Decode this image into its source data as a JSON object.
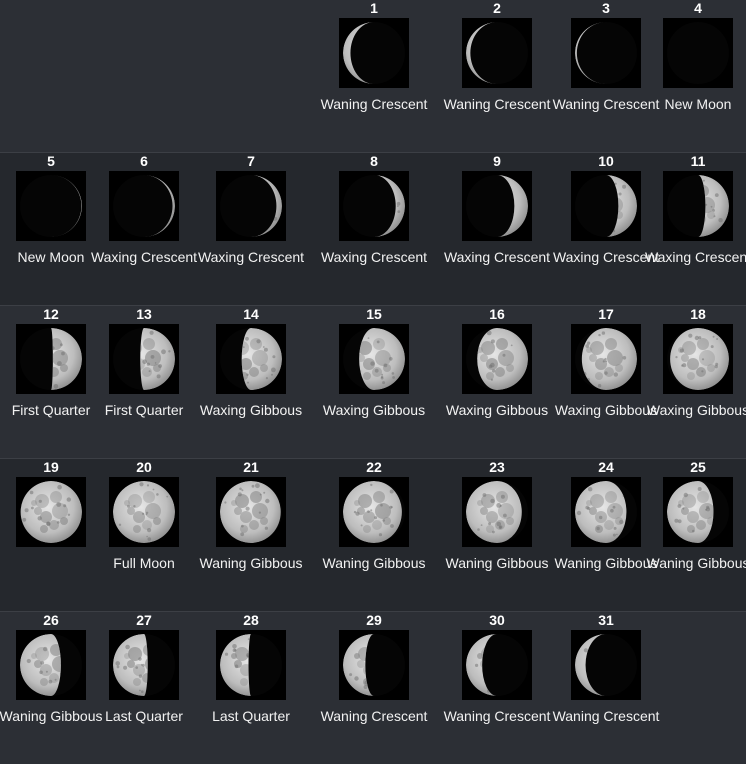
{
  "calendar": {
    "weeks": [
      {
        "days": [
          {
            "day": "1",
            "phase": "Waning Crescent",
            "illumination": 0.12,
            "waxing": false
          },
          {
            "day": "2",
            "phase": "Waning Crescent",
            "illumination": 0.07,
            "waxing": false
          },
          {
            "day": "3",
            "phase": "Waning Crescent",
            "illumination": 0.03,
            "waxing": false
          },
          {
            "day": "4",
            "phase": "New Moon",
            "illumination": 0.0,
            "waxing": false
          }
        ]
      },
      {
        "days": [
          {
            "day": "5",
            "phase": "New Moon",
            "illumination": 0.01,
            "waxing": true
          },
          {
            "day": "6",
            "phase": "Waxing Crescent",
            "illumination": 0.04,
            "waxing": true
          },
          {
            "day": "7",
            "phase": "Waxing Crescent",
            "illumination": 0.09,
            "waxing": true
          },
          {
            "day": "8",
            "phase": "Waxing Crescent",
            "illumination": 0.15,
            "waxing": true
          },
          {
            "day": "9",
            "phase": "Waxing Crescent",
            "illumination": 0.22,
            "waxing": true
          },
          {
            "day": "10",
            "phase": "Waxing Crescent",
            "illumination": 0.3,
            "waxing": true
          },
          {
            "day": "11",
            "phase": "Waxing Crescent",
            "illumination": 0.38,
            "waxing": true
          }
        ]
      },
      {
        "days": [
          {
            "day": "12",
            "phase": "First Quarter",
            "illumination": 0.47,
            "waxing": true
          },
          {
            "day": "13",
            "phase": "First Quarter",
            "illumination": 0.56,
            "waxing": true
          },
          {
            "day": "14",
            "phase": "Waxing Gibbous",
            "illumination": 0.65,
            "waxing": true
          },
          {
            "day": "15",
            "phase": "Waxing Gibbous",
            "illumination": 0.74,
            "waxing": true
          },
          {
            "day": "16",
            "phase": "Waxing Gibbous",
            "illumination": 0.82,
            "waxing": true
          },
          {
            "day": "17",
            "phase": "Waxing Gibbous",
            "illumination": 0.89,
            "waxing": true
          },
          {
            "day": "18",
            "phase": "Waxing Gibbous",
            "illumination": 0.95,
            "waxing": true
          }
        ]
      },
      {
        "days": [
          {
            "day": "19",
            "phase": "",
            "illumination": 0.99,
            "waxing": true
          },
          {
            "day": "20",
            "phase": "Full Moon",
            "illumination": 1.0,
            "waxing": true
          },
          {
            "day": "21",
            "phase": "Waning Gibbous",
            "illumination": 0.98,
            "waxing": false
          },
          {
            "day": "22",
            "phase": "Waning Gibbous",
            "illumination": 0.95,
            "waxing": false
          },
          {
            "day": "23",
            "phase": "Waning Gibbous",
            "illumination": 0.9,
            "waxing": false
          },
          {
            "day": "24",
            "phase": "Waning Gibbous",
            "illumination": 0.83,
            "waxing": false
          },
          {
            "day": "25",
            "phase": "Waning Gibbous",
            "illumination": 0.75,
            "waxing": false
          }
        ]
      },
      {
        "days": [
          {
            "day": "26",
            "phase": "Waning Gibbous",
            "illumination": 0.66,
            "waxing": false
          },
          {
            "day": "27",
            "phase": "Last Quarter",
            "illumination": 0.56,
            "waxing": false
          },
          {
            "day": "28",
            "phase": "Last Quarter",
            "illumination": 0.46,
            "waxing": false
          },
          {
            "day": "29",
            "phase": "Waning Crescent",
            "illumination": 0.36,
            "waxing": false
          },
          {
            "day": "30",
            "phase": "Waning Crescent",
            "illumination": 0.26,
            "waxing": false
          },
          {
            "day": "31",
            "phase": "Waning Crescent",
            "illumination": 0.17,
            "waxing": false
          }
        ]
      }
    ]
  }
}
